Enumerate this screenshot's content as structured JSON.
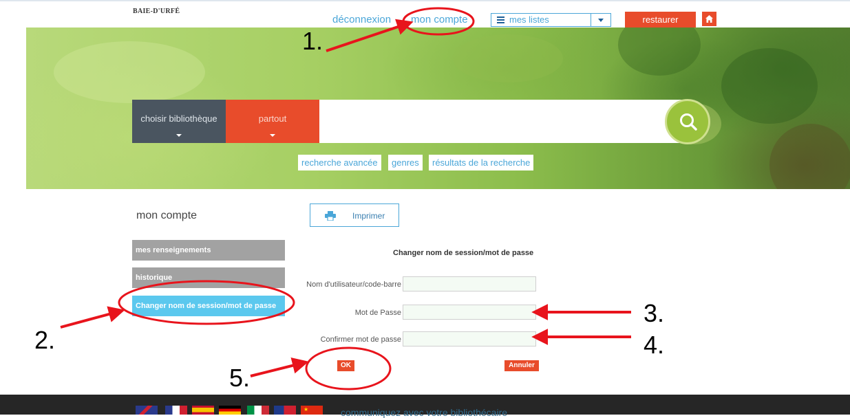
{
  "header": {
    "logo": "BAIE-D'URFÉ",
    "deconnexion": "déconnexion",
    "mon_compte": "mon compte",
    "mes_listes": "mes listes",
    "restaurer": "restaurer"
  },
  "search": {
    "library_select": "choisir bibliothèque",
    "scope_select": "partout",
    "links": [
      "recherche avancée",
      "genres",
      "résultats de la recherche"
    ]
  },
  "account": {
    "title": "mon compte",
    "print_label": "Imprimer",
    "sidebar": [
      "mes renseignements",
      "historique",
      "Changer nom de session/mot de passe"
    ]
  },
  "form": {
    "title": "Changer nom de session/mot de passe",
    "username_label": "Nom d'utilisateur/code-barre",
    "password_label": "Mot de Passe",
    "confirm_label": "Confirmer mot de passe",
    "ok_label": "OK",
    "cancel_label": "Annuler"
  },
  "footer": {
    "link": "communiquez avec votre bibliothécaire"
  },
  "annotations": [
    "1.",
    "2.",
    "3.",
    "4.",
    "5."
  ],
  "colors": {
    "accent_blue": "#4aa6d8",
    "accent_orange": "#e84c2b",
    "active_tab": "#5bc8ee",
    "annotation_red": "#e8141c"
  }
}
